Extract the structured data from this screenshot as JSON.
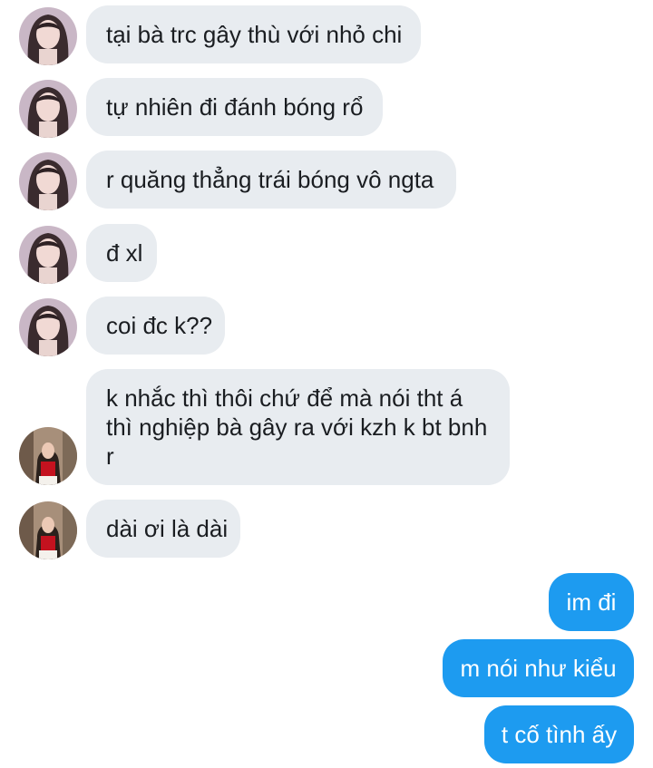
{
  "conversation": {
    "messages": [
      {
        "text": "tại bà trc gây thù với nhỏ chi",
        "sender": "friend-1",
        "avatar": "friend-1-avatar"
      },
      {
        "text": "tự nhiên đi đánh bóng rổ",
        "sender": "friend-1",
        "avatar": "friend-1-avatar"
      },
      {
        "text": "r quăng thẳng trái bóng vô ngta",
        "sender": "friend-1",
        "avatar": "friend-1-avatar"
      },
      {
        "text": "đ xl",
        "sender": "friend-1",
        "avatar": "friend-1-avatar"
      },
      {
        "text": "coi đc k??",
        "sender": "friend-1",
        "avatar": "friend-1-avatar"
      },
      {
        "text": "k nhắc thì thôi chứ để mà nói tht á thì nghiệp bà gây ra với kzh k bt bnh r",
        "sender": "friend-2",
        "avatar": "friend-2-avatar"
      },
      {
        "text": "dài ơi là dài",
        "sender": "friend-2",
        "avatar": "friend-2-avatar"
      },
      {
        "text": "im đi",
        "sender": "me"
      },
      {
        "text": "m nói như kiểu",
        "sender": "me"
      },
      {
        "text": "t cố tình ấy",
        "sender": "me"
      }
    ]
  },
  "colors": {
    "incoming_bubble": "#e8ecf0",
    "incoming_text": "#1a1d21",
    "outgoing_bubble": "#1d9bf0",
    "outgoing_text": "#ffffff",
    "background": "#ffffff"
  }
}
